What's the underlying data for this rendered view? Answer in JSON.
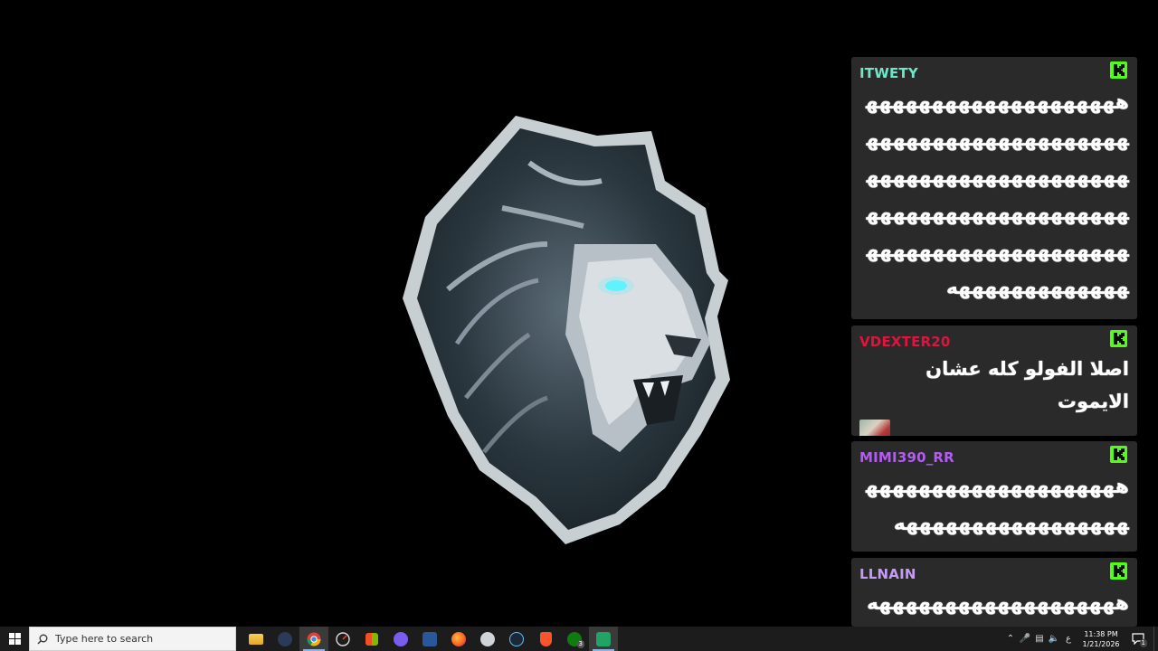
{
  "chat": {
    "messages": [
      {
        "username": "ITWETY",
        "user_color": "#6ee7c8",
        "text": "هههههههههههههههههههههههههههههههههههههههههههههههههههههههههههههههههههههههههههههههههههههههههههههههههههههههههههههههههه",
        "platform_icon": "kick-icon"
      },
      {
        "username": "VDEXTER20",
        "user_color": "#e0143c",
        "text": "اصلا الفولو كله عشان الايموت",
        "has_emote": true,
        "platform_icon": "kick-icon"
      },
      {
        "username": "MIMI390_RR",
        "user_color": "#b25cf0",
        "text": "هههههههههههههههههههههههههههههههههههههه",
        "platform_icon": "kick-icon"
      },
      {
        "username": "LLNAIN",
        "user_color": "#c59bf5",
        "text": "هههههههههههههههههههه",
        "platform_icon": "kick-icon"
      }
    ],
    "badge_color": "#53fc18"
  },
  "taskbar": {
    "search_placeholder": "Type here to search",
    "apps": [
      "file-explorer",
      "discord-bot",
      "chrome",
      "edge-like",
      "microsoft-store",
      "discord",
      "word",
      "firefox",
      "chatgpt",
      "steam",
      "brave",
      "xbox",
      "excel"
    ],
    "xbox_badge": "3",
    "tray": {
      "time": "11:38 PM",
      "date": "1/21/2026",
      "language": "ع",
      "notification_count": "1"
    }
  }
}
